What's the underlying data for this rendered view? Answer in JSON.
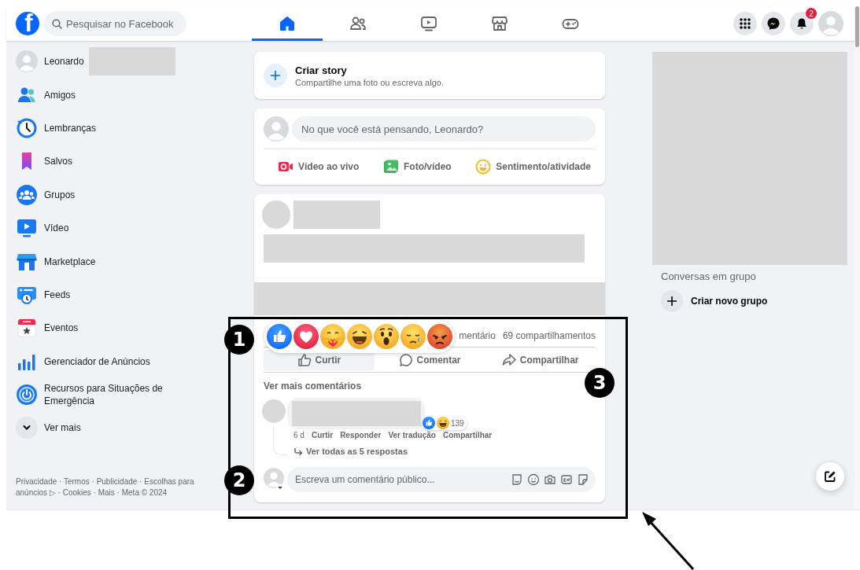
{
  "topbar": {
    "logo": "f",
    "search": {
      "placeholder": "Pesquisar no Facebook"
    },
    "tabs": [
      {
        "kind": "home",
        "selected": true
      },
      {
        "kind": "friends",
        "selected": false
      },
      {
        "kind": "video",
        "selected": false
      },
      {
        "kind": "marketplace",
        "selected": false
      },
      {
        "kind": "gaming",
        "selected": false
      }
    ],
    "notification_count": "2"
  },
  "sidebar": {
    "profile_name": "Leonardo",
    "items": [
      {
        "kind": "friends",
        "label": "Amigos"
      },
      {
        "kind": "memories",
        "label": "Lembranças"
      },
      {
        "kind": "saved",
        "label": "Salvos"
      },
      {
        "kind": "groups",
        "label": "Grupos"
      },
      {
        "kind": "video",
        "label": "Vídeo"
      },
      {
        "kind": "marketplace",
        "label": "Marketplace"
      },
      {
        "kind": "feeds",
        "label": "Feeds"
      },
      {
        "kind": "events",
        "label": "Eventos"
      },
      {
        "kind": "ads",
        "label": "Gerenciador de Anúncios"
      },
      {
        "kind": "emergency",
        "label": "Recursos para Situações de Emergência"
      }
    ],
    "see_more": "Ver mais",
    "footer": "Privacidade · Termos · Publicidade · Escolhas para anúncios ▷ · Cookies · Mais · Meta © 2024"
  },
  "story": {
    "title": "Criar story",
    "subtitle": "Compartilhe uma foto ou escreva algo."
  },
  "composer": {
    "placeholder": "No que você está pensando, Leonardo?",
    "actions": [
      {
        "kind": "live",
        "label": "Vídeo ao vivo"
      },
      {
        "kind": "photo",
        "label": "Foto/vídeo"
      },
      {
        "kind": "feeling",
        "label": "Sentimento/atividade"
      }
    ]
  },
  "post": {
    "reactions": [
      {
        "kind": "like"
      },
      {
        "kind": "love"
      },
      {
        "kind": "care"
      },
      {
        "kind": "haha"
      },
      {
        "kind": "wow"
      },
      {
        "kind": "sad"
      },
      {
        "kind": "angry"
      }
    ],
    "comments_count": "mentário",
    "shares_count": "69 compartilhamentos",
    "actions": [
      {
        "kind": "like",
        "label": "Curtir",
        "highlighted": true
      },
      {
        "kind": "comment",
        "label": "Comentar",
        "highlighted": false
      },
      {
        "kind": "share",
        "label": "Compartilhar",
        "highlighted": false
      }
    ],
    "more_comments": "Ver mais comentários",
    "comment": {
      "reaction_count": "139",
      "time": "6 d",
      "actions": [
        "Curtir",
        "Responder",
        "Ver tradução",
        "Compartilhar"
      ],
      "replies": "Ver todas as 5 respostas"
    },
    "comment_box": {
      "placeholder": "Escreva um comentário público...",
      "tools": [
        {
          "kind": "avatar-sticker"
        },
        {
          "kind": "emoji"
        },
        {
          "kind": "camera"
        },
        {
          "kind": "gif"
        },
        {
          "kind": "sticker"
        }
      ]
    }
  },
  "right": {
    "group_chats_title": "Conversas em grupo",
    "create_group": "Criar novo grupo"
  },
  "annotations": [
    {
      "label": "1"
    },
    {
      "label": "2"
    },
    {
      "label": "3"
    }
  ]
}
